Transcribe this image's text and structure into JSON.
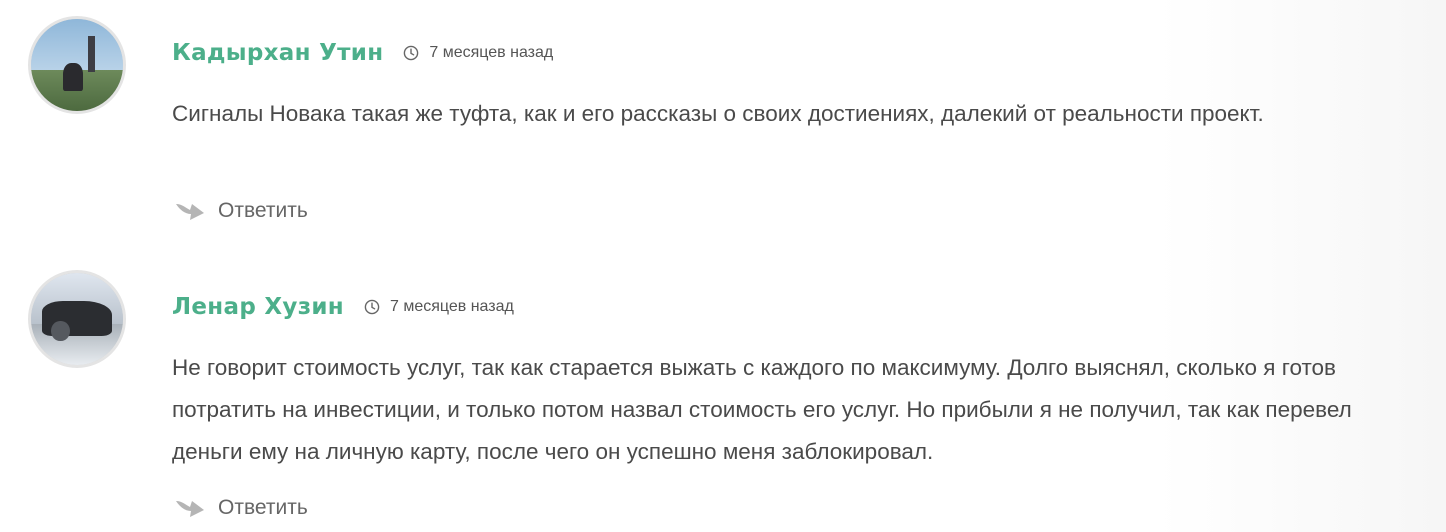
{
  "comments": [
    {
      "author": "Кадырхан Утин",
      "time": "7 месяцев назад",
      "text": "Сигналы Новака такая же туфта, как и его рассказы о своих достиениях, далекий от реальности проект.",
      "reply_label": "Ответить"
    },
    {
      "author": "Ленар Хузин",
      "time": "7 месяцев назад",
      "text": "Не говорит стоимость услуг, так как старается выжать с каждого по максимуму. Долго выяснял, сколько я готов потратить на инвестиции, и только потом назвал стоимость его услуг. Но прибыли я не получил, так как перевел деньги ему на личную карту, после чего он успешно меня заблокировал.",
      "reply_label": "Ответить"
    }
  ],
  "icons": {
    "time": "clock-icon",
    "reply": "reply-arrow-icon"
  },
  "colors": {
    "author": "#4caf8a",
    "text": "#4a4a4a",
    "icon": "#b5b5b5"
  }
}
